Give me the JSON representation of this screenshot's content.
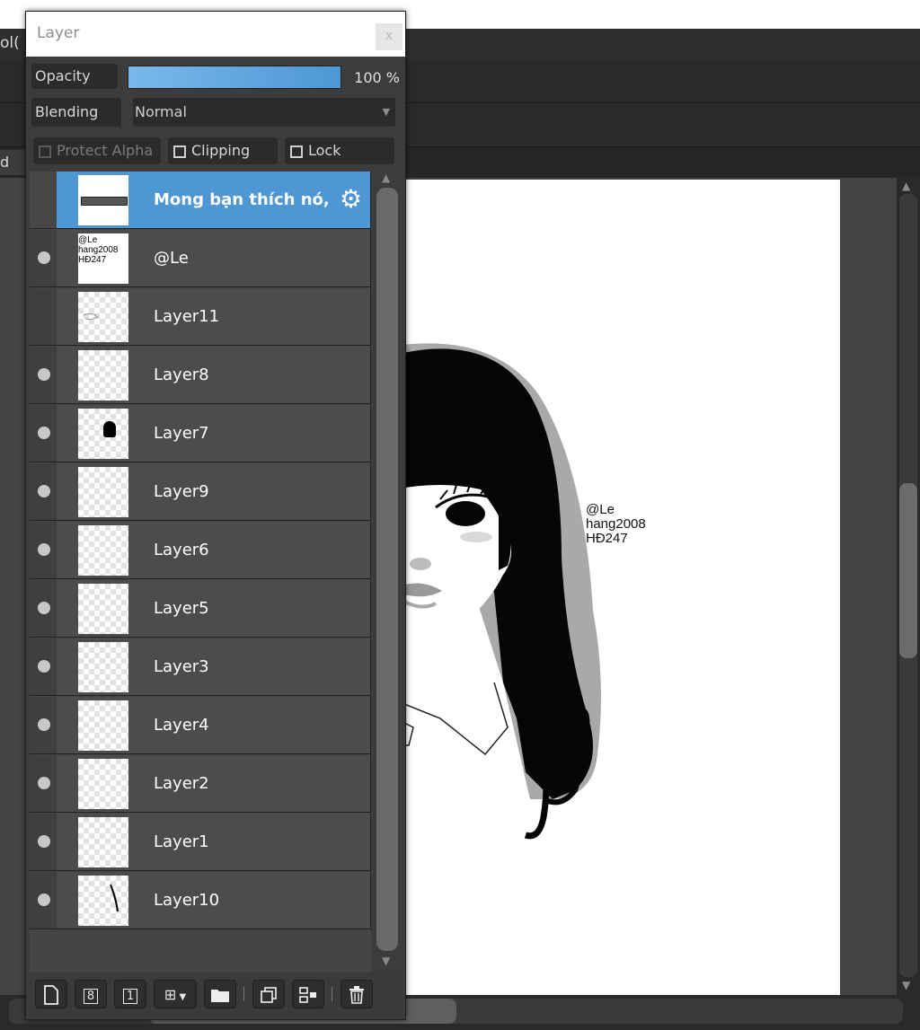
{
  "app": {
    "tool_label": "ol(",
    "tab_label": "d"
  },
  "panel": {
    "title": "Layer",
    "close_label": "x",
    "opacity_label": "Opacity",
    "opacity_value": "100 %",
    "opacity_fraction": 1.0,
    "blending_label": "Blending",
    "blending_value": "Normal",
    "protect_alpha_label": "Protect Alpha",
    "clipping_label": "Clipping",
    "lock_label": "Lock"
  },
  "layers": [
    {
      "name": "Mong bạn thích nó,",
      "selected": true,
      "visible": false,
      "thumb": "text-banner",
      "gear": "⚙"
    },
    {
      "name": "@Le",
      "selected": false,
      "visible": true,
      "thumb": "watermark-text"
    },
    {
      "name": "Layer11",
      "selected": false,
      "visible": false,
      "thumb": "sketch"
    },
    {
      "name": "Layer8",
      "selected": false,
      "visible": true,
      "thumb": "empty"
    },
    {
      "name": "Layer7",
      "selected": false,
      "visible": true,
      "thumb": "hair"
    },
    {
      "name": "Layer9",
      "selected": false,
      "visible": true,
      "thumb": "empty"
    },
    {
      "name": "Layer6",
      "selected": false,
      "visible": true,
      "thumb": "empty"
    },
    {
      "name": "Layer5",
      "selected": false,
      "visible": true,
      "thumb": "empty"
    },
    {
      "name": "Layer3",
      "selected": false,
      "visible": true,
      "thumb": "empty"
    },
    {
      "name": "Layer4",
      "selected": false,
      "visible": true,
      "thumb": "empty"
    },
    {
      "name": "Layer2",
      "selected": false,
      "visible": true,
      "thumb": "empty"
    },
    {
      "name": "Layer1",
      "selected": false,
      "visible": true,
      "thumb": "empty"
    },
    {
      "name": "Layer10",
      "selected": false,
      "visible": true,
      "thumb": "stroke"
    }
  ],
  "thumb_text": {
    "watermark_line1": "@Le",
    "watermark_line2": "hang2008",
    "watermark_line3": "HĐ247"
  },
  "canvas": {
    "watermark_line1": "@Le",
    "watermark_line2": "hang2008",
    "watermark_line3": "HĐ247"
  },
  "toolbar": [
    {
      "name": "new-layer-button",
      "icon": "new-layer-icon"
    },
    {
      "name": "new-8bit-layer-button",
      "icon": "8bit-layer-icon",
      "glyph": "8"
    },
    {
      "name": "new-1bit-layer-button",
      "icon": "1bit-layer-icon",
      "glyph": "1"
    },
    {
      "name": "add-layer-dropdown-button",
      "icon": "add-layer-icon"
    },
    {
      "name": "new-folder-button",
      "icon": "folder-icon"
    },
    {
      "name": "duplicate-layer-button",
      "icon": "duplicate-icon"
    },
    {
      "name": "merge-layer-button",
      "icon": "merge-icon"
    },
    {
      "name": "delete-layer-button",
      "icon": "trash-icon"
    }
  ],
  "colors": {
    "accent": "#4f97d3",
    "panel_bg": "#3c3c3c",
    "row_bg": "#4c4c4c"
  }
}
